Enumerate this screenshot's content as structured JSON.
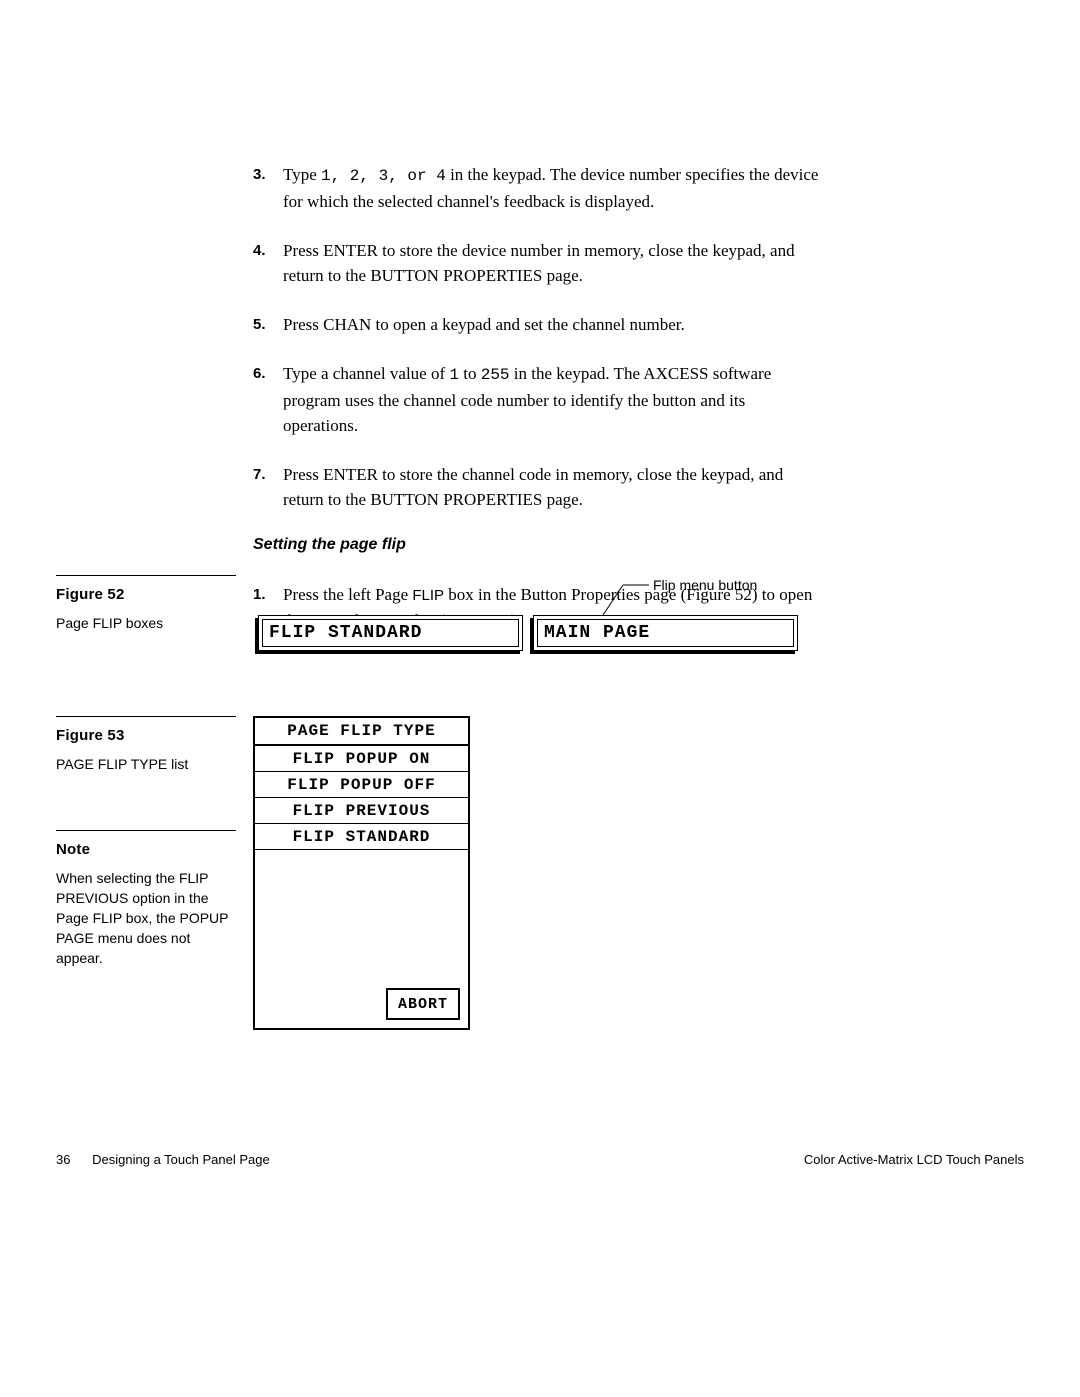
{
  "steps_top": [
    {
      "num": "3.",
      "html": "Type <span class='mono'>1, 2, 3, or 4</span> in the keypad. The device number specifies the device for which the selected channel's feedback is displayed."
    },
    {
      "num": "4.",
      "html": "Press ENTER to store the device number in memory, close the keypad, and return to the BUTTON PROPERTIES page."
    },
    {
      "num": "5.",
      "html": "Press CHAN to open a keypad and set the channel number."
    },
    {
      "num": "6.",
      "html": "Type a channel value of <span class='mono'>1</span> to <span class='mono'>255</span> in the keypad. The AXCESS software program uses the channel code number to identify the button and its operations."
    },
    {
      "num": "7.",
      "html": "Press ENTER to store the channel code in memory, close the keypad, and return to the BUTTON PROPERTIES page."
    }
  ],
  "subheading": "Setting the page flip",
  "steps_bottom": [
    {
      "num": "1.",
      "html": "Press the left Page <span class='sans-small'>FLIP</span> box in the Button Properties page (Figure 52) to open the Page Flip Type list (Figure 53)."
    }
  ],
  "fig52": {
    "heading": "Figure 52",
    "caption": "Page FLIP boxes",
    "box_left": "FLIP STANDARD",
    "box_right": "MAIN PAGE",
    "callout": "Flip menu button"
  },
  "fig53": {
    "heading": "Figure 53",
    "caption": "PAGE FLIP TYPE list",
    "title": "PAGE FLIP TYPE",
    "items": [
      "FLIP POPUP ON",
      "FLIP POPUP OFF",
      "FLIP PREVIOUS",
      "FLIP STANDARD"
    ],
    "abort": "ABORT"
  },
  "note": {
    "heading": "Note",
    "text": "When selecting the FLIP PREVIOUS option in the Page FLIP box, the POPUP PAGE menu does not appear."
  },
  "footer": {
    "page_number": "36",
    "left": "Designing a Touch Panel Page",
    "right": "Color Active-Matrix LCD Touch Panels"
  }
}
